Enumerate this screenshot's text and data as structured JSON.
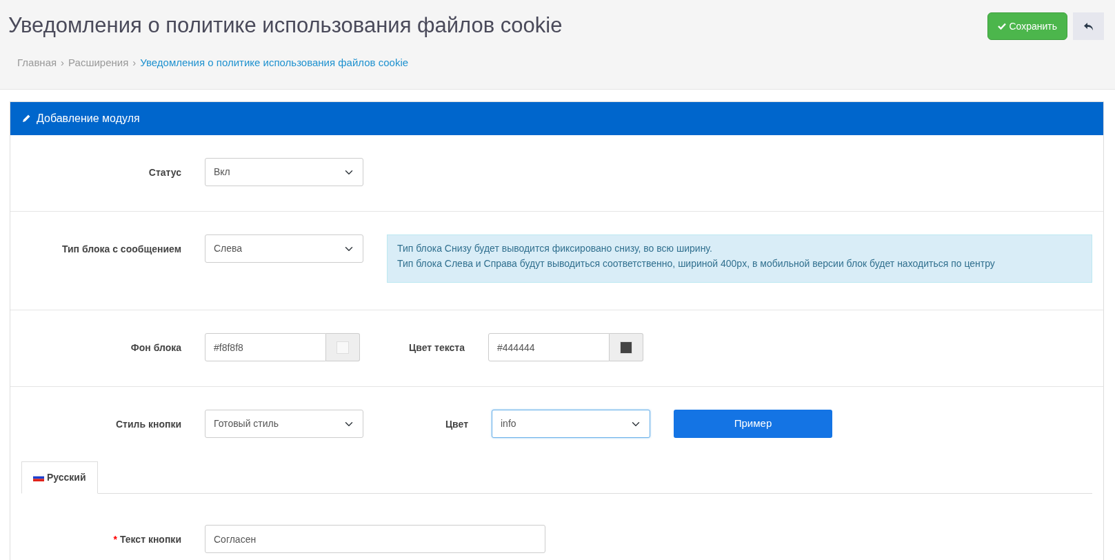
{
  "header": {
    "title": "Уведомления о политике использования файлов cookie",
    "buttons": [
      {
        "kind": "save",
        "label": "Сохранить"
      },
      {
        "kind": "back"
      }
    ],
    "breadcrumb_separator": "›",
    "breadcrumbs": [
      {
        "label": "Главная",
        "active": false
      },
      {
        "label": "Расширения",
        "active": false
      },
      {
        "label": "Уведомления о политике использования файлов cookie",
        "active": true
      }
    ]
  },
  "panel": {
    "title": "Добавление модуля",
    "rows": [
      {
        "fields": [
          {
            "kind": "select",
            "label": "Статус",
            "value": "Вкл",
            "focused": false
          }
        ]
      },
      {
        "fields": [
          {
            "kind": "select",
            "label": "Тип блока с сообщением",
            "value": "Слева",
            "focused": false
          },
          {
            "kind": "info",
            "lines": [
              "Тип блока Снизу будет выводится фиксировано снизу, во всю ширину.",
              "Тип блока Слева и Справа будут выводиться соответственно, шириной 400px, в мобильной версии блок будет находиться по центру"
            ]
          }
        ]
      },
      {
        "fields": [
          {
            "kind": "color",
            "label": "Фон блока",
            "value": "#f8f8f8"
          },
          {
            "kind": "color",
            "label": "Цвет текста",
            "value": "#444444"
          }
        ]
      },
      {
        "fields": [
          {
            "kind": "select",
            "label": "Стиль кнопки",
            "value": "Готовый стиль",
            "focused": false
          },
          {
            "kind": "select",
            "label": "Цвет",
            "value": "info",
            "focused": true
          },
          {
            "kind": "button",
            "label": "Пример"
          }
        ]
      }
    ],
    "tabs": [
      {
        "label": "Русский",
        "selected": true
      }
    ],
    "tab_rows": [
      {
        "fields": [
          {
            "kind": "text",
            "label": "Текст кнопки",
            "value": "Согласен",
            "required_mark": "*"
          }
        ]
      }
    ]
  }
}
